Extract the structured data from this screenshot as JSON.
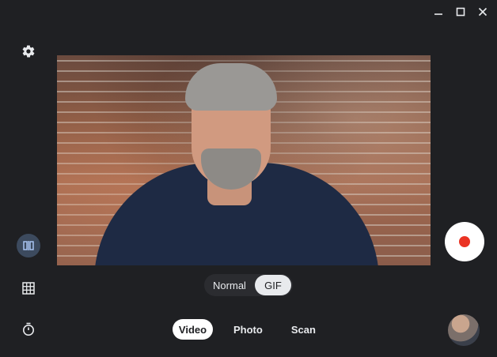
{
  "window": {
    "controls": [
      "minimize-icon",
      "maximize-icon",
      "close-icon"
    ]
  },
  "sidebar": {
    "icons": [
      "gear-icon",
      "mirror-icon",
      "grid-icon",
      "timer-icon"
    ]
  },
  "mode_toggle": {
    "options": [
      "Normal",
      "GIF"
    ],
    "selected": "GIF"
  },
  "capture_tabs": {
    "items": [
      "Video",
      "Photo",
      "Scan"
    ],
    "selected": "Video"
  },
  "colors": {
    "background": "#1f2023",
    "record_dot": "#ea3323",
    "mirror_active_bg": "#3c4a5e"
  }
}
